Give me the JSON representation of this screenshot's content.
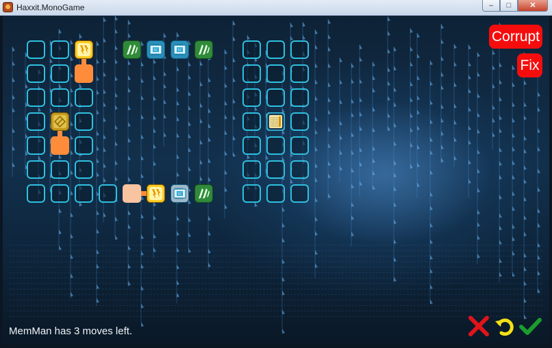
{
  "window": {
    "title": "Haxxit.MonoGame",
    "minimize": "–",
    "maximize": "□",
    "close": "✕"
  },
  "buttons": {
    "corrupt": "Corrupt",
    "fix": "Fix"
  },
  "status": "MemMan has 3 moves left.",
  "controls": [
    "cancel-icon",
    "undo-icon",
    "confirm-icon"
  ],
  "colors": {
    "cell_border": "#2fc0e0",
    "button_red": "#f50d0d",
    "orange": "#ff8c3a",
    "peach": "#f9c4a0",
    "yellow": "#ffcc22",
    "green": "#2f8a3a"
  }
}
